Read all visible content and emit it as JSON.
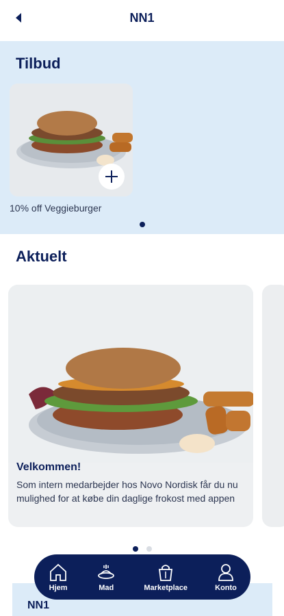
{
  "header": {
    "title": "NN1"
  },
  "offers": {
    "section_title": "Tilbud",
    "items": [
      {
        "label": "10% off Veggieburger"
      }
    ]
  },
  "news": {
    "section_title": "Aktuelt",
    "items": [
      {
        "title": "Velkommen!",
        "text": "Som intern medarbejder hos Novo Nordisk får du nu mulighed for at købe din daglige frokost med appen"
      }
    ]
  },
  "navbar": {
    "items": [
      {
        "label": "Hjem",
        "icon": "home-icon"
      },
      {
        "label": "Mad",
        "icon": "food-icon"
      },
      {
        "label": "Marketplace",
        "icon": "shopping-bag-icon"
      },
      {
        "label": "Konto",
        "icon": "person-icon"
      }
    ]
  },
  "footer_strip": {
    "title": "NN1"
  },
  "colors": {
    "primary": "#0c1f5a",
    "section_bg": "#dcebf8",
    "text": "#2b3550"
  }
}
